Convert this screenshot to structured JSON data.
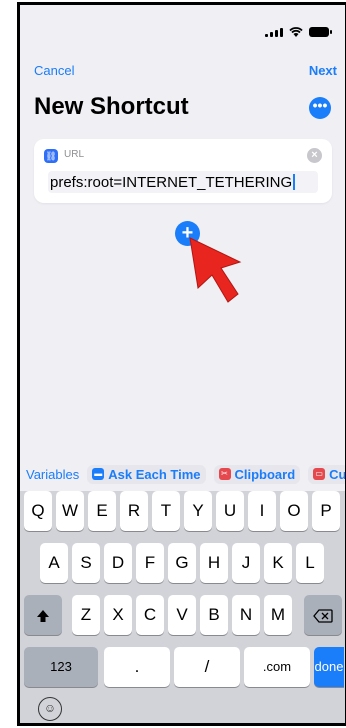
{
  "nav": {
    "cancel": "Cancel",
    "next": "Next",
    "title": "New Shortcut",
    "more_icon": "ellipsis-icon"
  },
  "action_card": {
    "icon": "link-icon",
    "label": "URL",
    "value": "prefs:root=INTERNET_TETHERING",
    "clear_icon": "clear-icon"
  },
  "add_button": {
    "icon": "plus-icon",
    "label": "+"
  },
  "suggestions": {
    "variables": "Variables",
    "chips": [
      {
        "label": "Ask Each Time",
        "icon": "speech-bubble-icon",
        "color": "#1a7dfa"
      },
      {
        "label": "Clipboard",
        "icon": "scissors-icon",
        "color": "#e5484d"
      },
      {
        "label": "Cu",
        "icon": "calendar-icon",
        "color": "#e5484d"
      }
    ]
  },
  "keyboard": {
    "row1": [
      "Q",
      "W",
      "E",
      "R",
      "T",
      "Y",
      "U",
      "I",
      "O",
      "P"
    ],
    "row2": [
      "A",
      "S",
      "D",
      "F",
      "G",
      "H",
      "J",
      "K",
      "L"
    ],
    "row3": [
      "Z",
      "X",
      "C",
      "V",
      "B",
      "N",
      "M"
    ],
    "row4": {
      "numbers": "123",
      "dot": ".",
      "slash": "/",
      "dotcom": ".com",
      "done": "done"
    }
  },
  "colors": {
    "accent": "#1a7dfa",
    "arrow": "#e8251f"
  }
}
